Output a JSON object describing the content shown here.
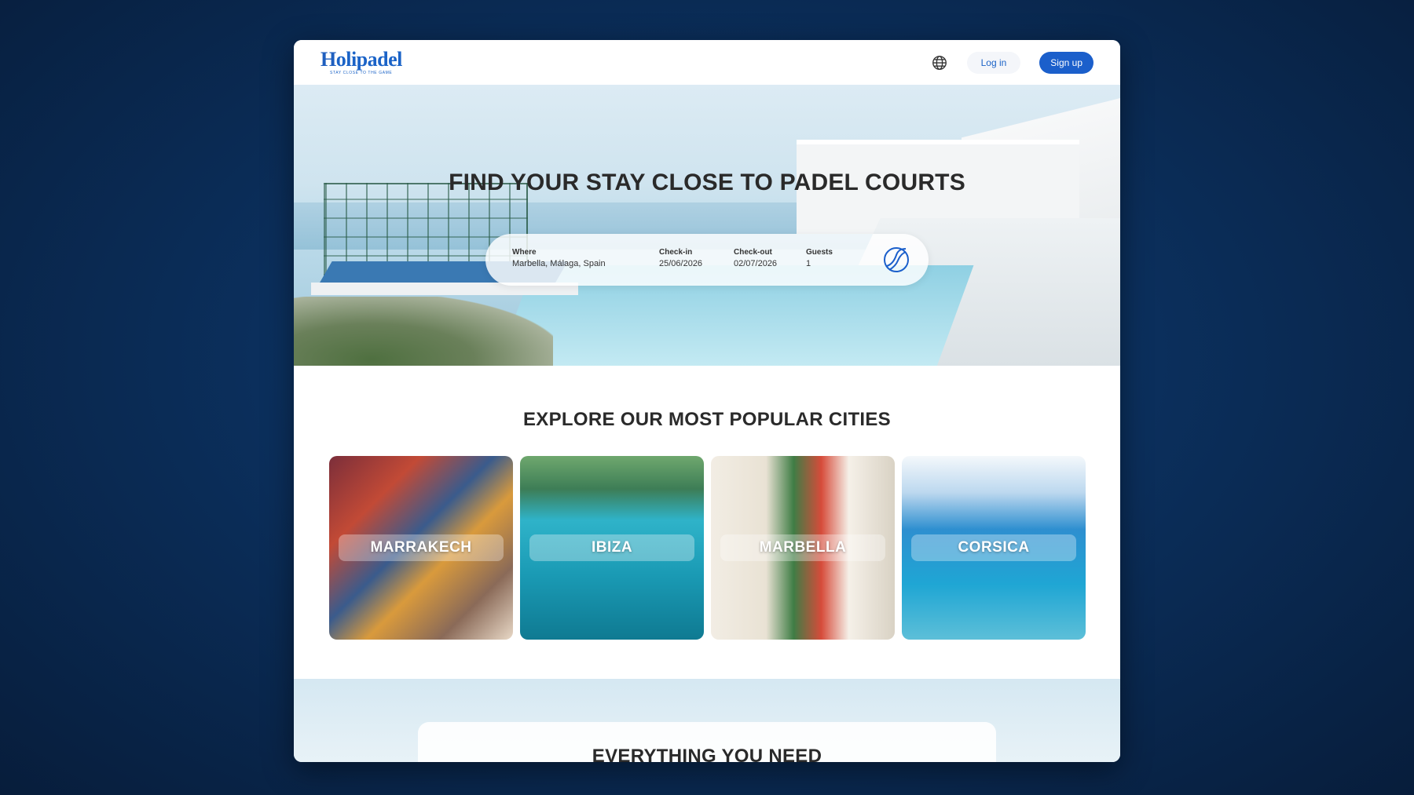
{
  "header": {
    "logo": {
      "first": "H",
      "rest": "olipadel",
      "tagline": "STAY CLOSE TO THE GAME"
    },
    "globe_icon": "globe-icon",
    "login_label": "Log in",
    "signup_label": "Sign up"
  },
  "hero": {
    "title": "FIND YOUR STAY CLOSE TO PADEL COURTS",
    "search": {
      "where_label": "Where",
      "where_value": "Marbella, Málaga, Spain",
      "checkin_label": "Check-in",
      "checkin_value": "25/06/2026",
      "checkout_label": "Check-out",
      "checkout_value": "02/07/2026",
      "guests_label": "Guests",
      "guests_value": "1",
      "button_icon": "padel-ball-icon"
    }
  },
  "cities": {
    "title": "EXPLORE OUR MOST POPULAR CITIES",
    "items": [
      {
        "name": "MARRAKECH"
      },
      {
        "name": "IBIZA"
      },
      {
        "name": "MARBELLA"
      },
      {
        "name": "CORSICA"
      }
    ]
  },
  "features": {
    "title": "EVERYTHING YOU NEED"
  },
  "colors": {
    "brand_blue": "#1b5fcb",
    "logo_accent": "#f2a21b",
    "background": "#0b2f5c"
  }
}
